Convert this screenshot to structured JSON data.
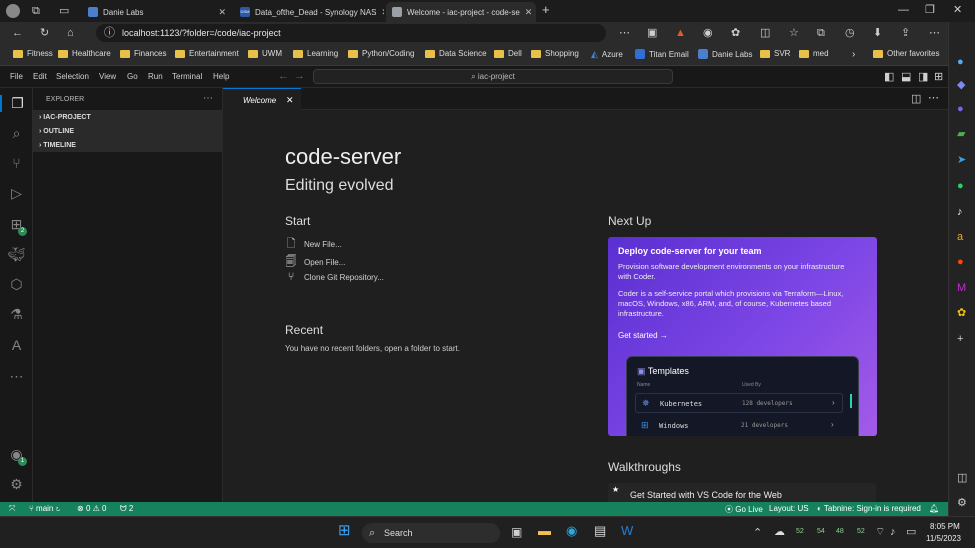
{
  "browser": {
    "tabs": [
      {
        "title": "Danie Labs",
        "favicon": "#4a7fd0"
      },
      {
        "title": "Data_ofthe_Dead - Synology NAS",
        "favicon": "#2b58a8",
        "favicon_text": "DSM"
      },
      {
        "title": "Welcome - iac-project - code-se",
        "favicon": "#9aa0a6"
      }
    ],
    "url": "localhost:1123/?folder=/code/iac-project",
    "bookmarks": [
      "Fitness",
      "Healthcare",
      "Finances",
      "Entertainment",
      "UWM",
      "Learning",
      "Python/Coding",
      "Data Science",
      "Dell",
      "Shopping",
      "Azure",
      "Titan Email",
      "Danie Labs",
      "SVR",
      "med",
      "Other favorites"
    ]
  },
  "menu": [
    "File",
    "Edit",
    "Selection",
    "View",
    "Go",
    "Run",
    "Terminal",
    "Help"
  ],
  "command_center": "iac-project",
  "sidebar": {
    "title": "EXPLORER",
    "sections": [
      "IAC-PROJECT",
      "OUTLINE",
      "TIMELINE"
    ],
    "extensions_badge": "2",
    "accounts_badge": "1"
  },
  "editor_tab": {
    "label": "Welcome"
  },
  "welcome": {
    "title": "code-server",
    "subtitle": "Editing evolved",
    "start_heading": "Start",
    "start_items": [
      "New File...",
      "Open File...",
      "Clone Git Repository..."
    ],
    "recent_heading": "Recent",
    "recent_text": "You have no recent folders, open a folder to start.",
    "next_up_heading": "Next Up",
    "card": {
      "title": "Deploy code-server for your team",
      "p1": "Provision software development environments on your infrastructure with Coder.",
      "p2": "Coder is a self-service portal which provisions via Terraform—Linux, macOS, Windows, x86, ARM, and, of course, Kubernetes based infrastructure.",
      "cta": "Get started",
      "templates": {
        "title": "Templates",
        "col_name": "Name",
        "col_used": "Used By",
        "rows": [
          {
            "name": "Kubernetes",
            "used": "128 developers"
          },
          {
            "name": "Windows",
            "used": "21 developers"
          }
        ]
      }
    },
    "walkthroughs_heading": "Walkthroughs",
    "walkthrough_item": "Get Started with VS Code for the Web"
  },
  "status": {
    "branch": "main",
    "problems": "0",
    "warnings": "0",
    "ports": "2",
    "go_live": "Go Live",
    "layout": "Layout: US",
    "tabnine": "Tabnine: Sign-in is required"
  },
  "taskbar": {
    "search": "Search",
    "tray_numbers": [
      "52",
      "54",
      "48",
      "52"
    ],
    "time": "8:05 PM",
    "date": "11/5/2023"
  }
}
